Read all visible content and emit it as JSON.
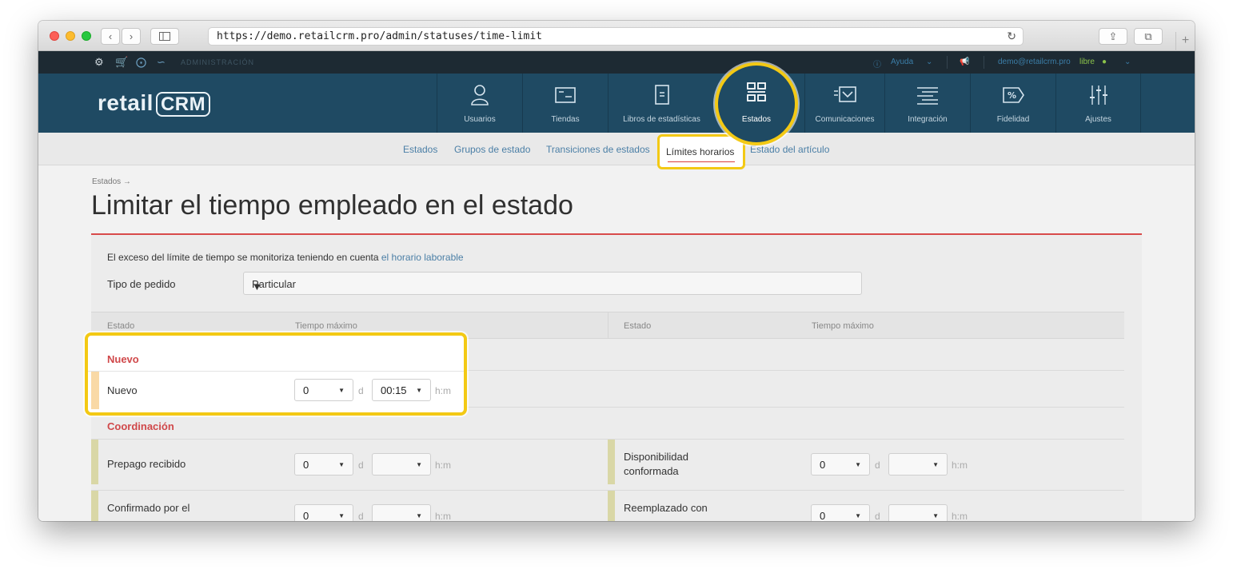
{
  "browser": {
    "url": "https://demo.retailcrm.pro/admin/statuses/time-limit"
  },
  "topbar": {
    "admin_label": "ADMINISTRACIÓN",
    "help_label": "Ayuda",
    "user_email": "demo@retailcrm.pro",
    "user_plan": "libre"
  },
  "logo": {
    "text_a": "retail",
    "text_b": "CRM"
  },
  "nav": {
    "items": [
      {
        "label": "Usuarios",
        "icon": "user-icon"
      },
      {
        "label": "Tiendas",
        "icon": "store-icon"
      },
      {
        "label": "Libros de estadísticas",
        "icon": "book-icon"
      },
      {
        "label": "Estados",
        "icon": "statuses-icon"
      },
      {
        "label": "Comunicaciones",
        "icon": "mail-icon"
      },
      {
        "label": "Integración",
        "icon": "integration-icon"
      },
      {
        "label": "Fidelidad",
        "icon": "percent-tag-icon"
      },
      {
        "label": "Ajustes",
        "icon": "sliders-icon"
      }
    ]
  },
  "subnav": {
    "items": [
      "Estados",
      "Grupos de estado",
      "Transiciones de estados",
      "Límites horarios",
      "Estado del artículo"
    ],
    "active": "Límites horarios"
  },
  "breadcrumb": "Estados →",
  "page_title": "Limitar el tiempo empleado en el estado",
  "note": {
    "text": "El exceso del límite de tiempo se monitoriza teniendo en cuenta ",
    "link": "el horario laborable"
  },
  "order_type": {
    "label": "Tipo de pedido",
    "value": "Particular"
  },
  "table_headers": {
    "status": "Estado",
    "max_time": "Tiempo máximo"
  },
  "units": {
    "days": "d",
    "hours": "h:m"
  },
  "groups": [
    {
      "title": "Nuevo",
      "rows": [
        {
          "label": "Nuevo",
          "days": "0",
          "time": "00:15"
        }
      ]
    },
    {
      "title": "Coordinación",
      "rows_left": [
        {
          "label": "Prepago recibido",
          "days": "0",
          "time": ""
        },
        {
          "label": "Confirmado por el",
          "days": "0",
          "time": ""
        }
      ],
      "rows_right": [
        {
          "label": "Disponibilidad conformada",
          "days": "0",
          "time": ""
        },
        {
          "label": "Reemplazado con",
          "days": "0",
          "time": ""
        }
      ]
    }
  ],
  "colors": {
    "accent_yellow": "#f3c914",
    "header_blue": "#1f4a63",
    "group_red": "#d0484a"
  }
}
